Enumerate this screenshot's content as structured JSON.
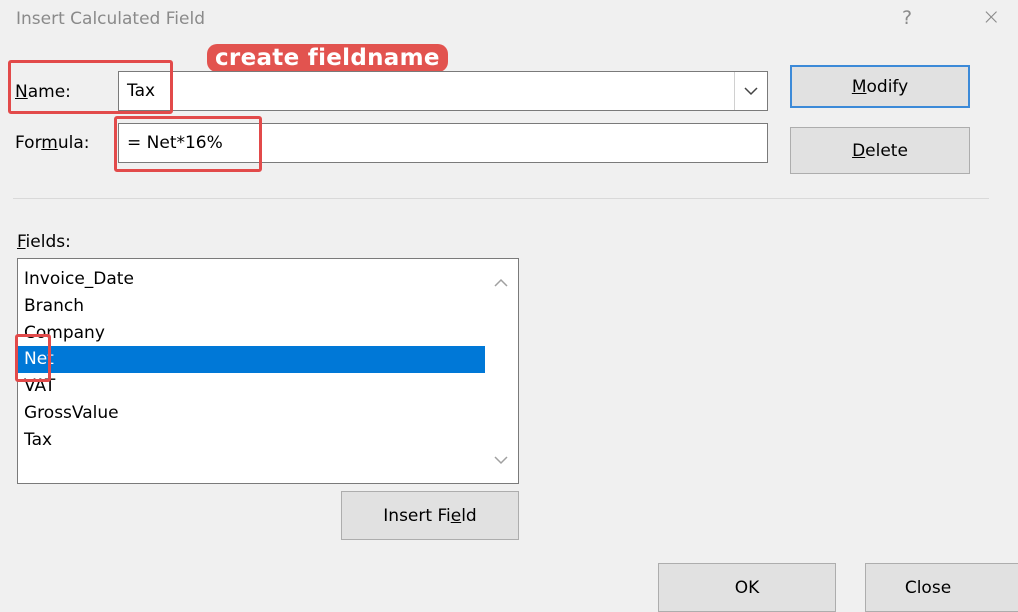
{
  "window": {
    "title": "Insert Calculated Field",
    "help_glyph": "?",
    "close_glyph": "×"
  },
  "annotation": {
    "text": "create fieldname",
    "color": "#e2534f"
  },
  "form": {
    "name_label_u": "N",
    "name_label_rest": "ame:",
    "name_value": "Tax",
    "formula_label_pre": "For",
    "formula_label_u": "m",
    "formula_label_rest": "ula:",
    "formula_value": "= Net*16%"
  },
  "buttons": {
    "modify_u": "M",
    "modify_rest": "odify",
    "delete_u": "D",
    "delete_rest": "elete",
    "insert_field_pre": "Insert Fi",
    "insert_field_u": "e",
    "insert_field_rest": "ld",
    "ok": "OK",
    "close": "Close"
  },
  "fields": {
    "label_u": "F",
    "label_rest": "ields:",
    "items": [
      "Invoice_Date",
      "Branch",
      "Company",
      "Net",
      "VAT",
      "GrossValue",
      "Tax"
    ],
    "selected": "Net"
  },
  "colors": {
    "accent": "#0078d7",
    "highlight": "#e24a4a",
    "default_button_border": "#3c8ad8"
  }
}
